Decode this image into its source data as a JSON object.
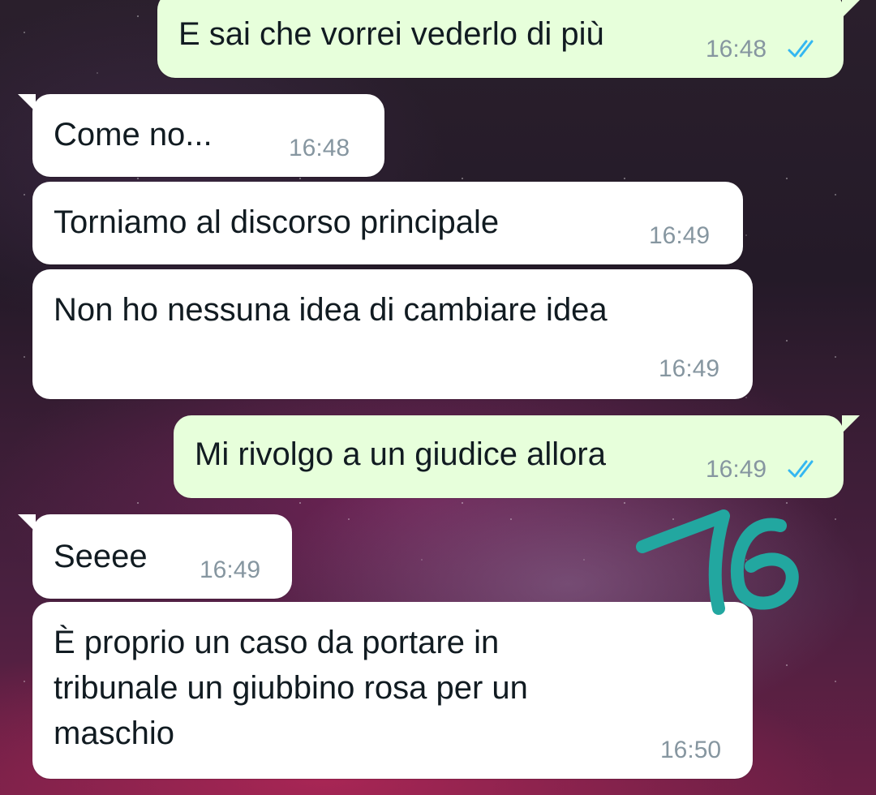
{
  "chat": {
    "messages": [
      {
        "direction": "out",
        "text": "E sai che vorrei vederlo di più",
        "time": "16:48",
        "status": "read-double-check-icon"
      },
      {
        "direction": "in",
        "text": "Come no...",
        "time": "16:48"
      },
      {
        "direction": "in",
        "text": "Torniamo al discorso principale",
        "time": "16:49"
      },
      {
        "direction": "in",
        "text": "Non ho nessuna idea di cambiare idea",
        "time": "16:49"
      },
      {
        "direction": "out",
        "text": "Mi rivolgo a un giudice allora",
        "time": "16:49",
        "status": "read-double-check-icon"
      },
      {
        "direction": "in",
        "text": "Seeee",
        "time": "16:49"
      },
      {
        "direction": "in",
        "lines": [
          "È proprio un caso da portare in",
          "tribunale un giubbino rosa per un",
          "maschio"
        ],
        "time": "16:50"
      }
    ]
  },
  "annotation": {
    "text": "16",
    "color": "#22a7a0"
  },
  "colors": {
    "incoming_bubble": "#ffffff",
    "outgoing_bubble": "#e7ffdb",
    "timestamp": "#8696a0",
    "read_ticks": "#34b7f1"
  }
}
